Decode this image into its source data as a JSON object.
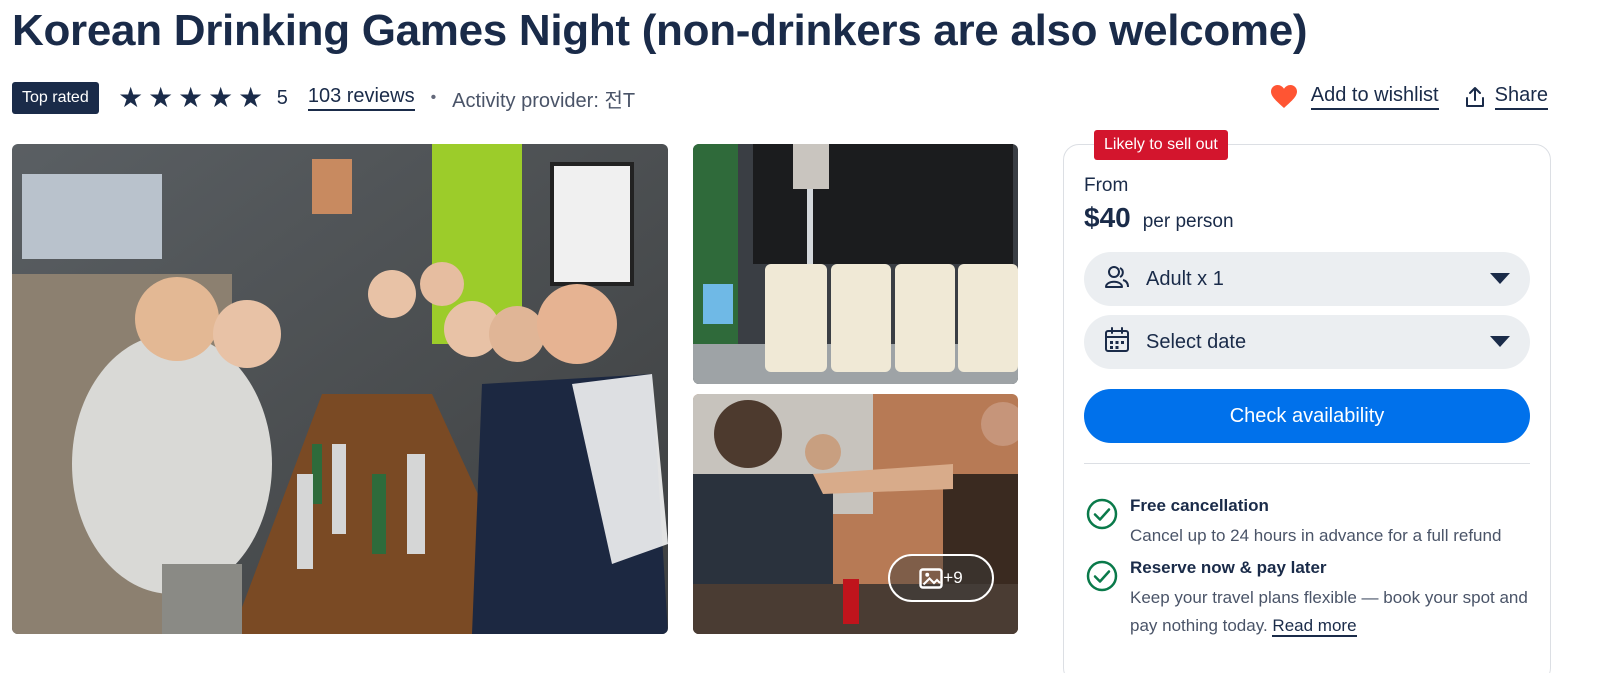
{
  "header": {
    "title": "Korean Drinking Games Night (non-drinkers are also welcome)",
    "badge": "Top rated",
    "rating": "5",
    "star_count": 5,
    "reviews": "103 reviews",
    "separator": "•",
    "provider": "Activity provider: 전T"
  },
  "actions": {
    "wishlist": "Add to wishlist",
    "share": "Share"
  },
  "gallery": {
    "more_photos": "+9"
  },
  "booking": {
    "urgency_badge": "Likely to sell out",
    "from_label": "From",
    "price": "$40",
    "price_unit": "per person",
    "participants": "Adult x 1",
    "date_placeholder": "Select date",
    "cta": "Check availability"
  },
  "features": [
    {
      "title": "Free cancellation",
      "description": "Cancel up to 24 hours in advance for a full refund"
    },
    {
      "title": "Reserve now & pay later",
      "description": "Keep your travel plans flexible — book your spot and pay nothing today.",
      "link": "Read more"
    }
  ],
  "colors": {
    "text_primary": "#1a2b49",
    "accent_blue": "#0071eb",
    "urgency_red": "#d3152d",
    "heart": "#ff5533",
    "check_green": "#0a7a4a"
  },
  "icons": {
    "wishlist": "heart-icon",
    "share": "share-icon",
    "participants": "users-icon",
    "date": "calendar-icon",
    "gallery": "image-icon",
    "feature": "check-circle-icon"
  }
}
